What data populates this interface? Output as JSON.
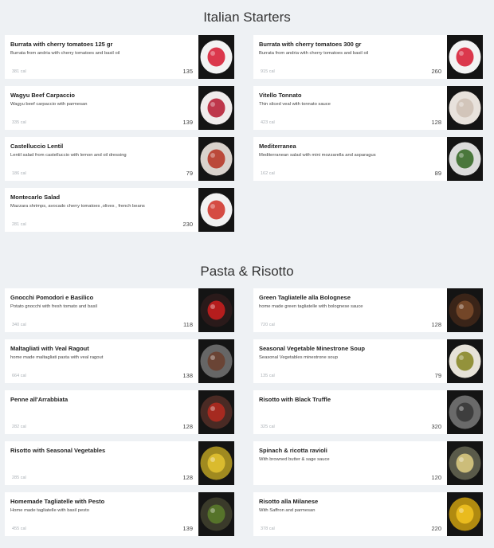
{
  "sections": [
    {
      "title": "Italian Starters",
      "items": [
        {
          "name": "Burrata with cherry tomatoes 125 gr",
          "desc": "Burrata from andria with cherry tomatoes and basil oil",
          "cal": "381 cal",
          "price": "135",
          "img": "burrata-plate",
          "plate": "#f3f3f3",
          "food": "#d8243a"
        },
        {
          "name": "Burrata with cherry tomatoes 300 gr",
          "desc": "Burrata from andria with cherry tomatoes and basil oil",
          "cal": "915 cal",
          "price": "260",
          "img": "burrata-plate",
          "plate": "#f3f3f3",
          "food": "#d8243a"
        },
        {
          "name": "Wagyu Beef Carpaccio",
          "desc": "Wagyu beef carpaccio with parmesan",
          "cal": "335 cal",
          "price": "139",
          "img": "carpaccio-plate",
          "plate": "#f0ecec",
          "food": "#b8243a"
        },
        {
          "name": "Vitello Tonnato",
          "desc": "Thin sliced veal with tonnato sauce",
          "cal": "423 cal",
          "price": "128",
          "img": "vitello-plate",
          "plate": "#e8e2dc",
          "food": "#cfc2b6"
        },
        {
          "name": "Castelluccio Lentil",
          "desc": "Lentil salad from castelluccio with lemon and oil dressing",
          "cal": "186 cal",
          "price": "79",
          "img": "lentil-bowl",
          "plate": "#d9d2cc",
          "food": "#b73a2a"
        },
        {
          "name": "Mediterranea",
          "desc": "Mediterranean salad with mini mozzarella and asparagus",
          "cal": "162 cal",
          "price": "89",
          "img": "salad-plate",
          "plate": "#dcdcdc",
          "food": "#3a6b2a"
        },
        {
          "name": "Montecarlo Salad",
          "desc": "Mazzara shrimps, avocado cherry tomatoes ,olives , french beans",
          "cal": "281 cal",
          "price": "230",
          "img": "montecarlo-plate",
          "plate": "#f2f2f2",
          "food": "#d23a30"
        }
      ]
    },
    {
      "title": "Pasta & Risotto",
      "items": [
        {
          "name": "Gnocchi Pomodori e Basilico",
          "desc": "Potato gnocchi with fresh tomato and basil",
          "cal": "340 cal",
          "price": "118",
          "img": "gnocchi-dish",
          "plate": "#2a1a1a",
          "food": "#c41e1e"
        },
        {
          "name": "Green Tagliatelle alla Bolognese",
          "desc": "home made green tagliatelle with bolognese sauce",
          "cal": "720 cal",
          "price": "128",
          "img": "tagliatelle-pan",
          "plate": "#3a2418",
          "food": "#7a4a2a"
        },
        {
          "name": "Maltagliati with Veal Ragout",
          "desc": "home made maltagliati pasta with veal ragout",
          "cal": "664 cal",
          "price": "138",
          "img": "maltagliati-pan",
          "plate": "#666666",
          "food": "#6a4030"
        },
        {
          "name": "Seasonal Vegetable Minestrone Soup",
          "desc": "Seasonal Vegetables minestrone soup",
          "cal": "135 cal",
          "price": "79",
          "img": "soup-bowl",
          "plate": "#e6e2d8",
          "food": "#8a8a2a"
        },
        {
          "name": "Penne all'Arrabbiata",
          "desc": "",
          "cal": "282 cal",
          "price": "128",
          "img": "penne-pan",
          "plate": "#4a2a24",
          "food": "#b02a20"
        },
        {
          "name": "Risotto with Black Truffle",
          "desc": "",
          "cal": "325 cal",
          "price": "320",
          "img": "truffle-risotto",
          "plate": "#6a6a6a",
          "food": "#3a3a3a"
        },
        {
          "name": "Risotto with Seasonal Vegetables",
          "desc": "",
          "cal": "285 cal",
          "price": "128",
          "img": "vegetable-risotto",
          "plate": "#a08a20",
          "food": "#e0c030"
        },
        {
          "name": "Spinach & ricotta ravioli",
          "desc": "With browned butter & sage sauce",
          "cal": "",
          "price": "120",
          "img": "ravioli-pan",
          "plate": "#5a5a4a",
          "food": "#d8c880"
        },
        {
          "name": "Homemade Tagliatelle with Pesto",
          "desc": "Home made tagliatelle with basil pesto",
          "cal": "455 cal",
          "price": "139",
          "img": "pesto-pan",
          "plate": "#3a3a2a",
          "food": "#5a7a2a"
        },
        {
          "name": "Risotto alla Milanese",
          "desc": "With Saffron and parmesan",
          "cal": "378 cal",
          "price": "220",
          "img": "milanese-risotto",
          "plate": "#b08a10",
          "food": "#f0c020"
        }
      ]
    }
  ]
}
